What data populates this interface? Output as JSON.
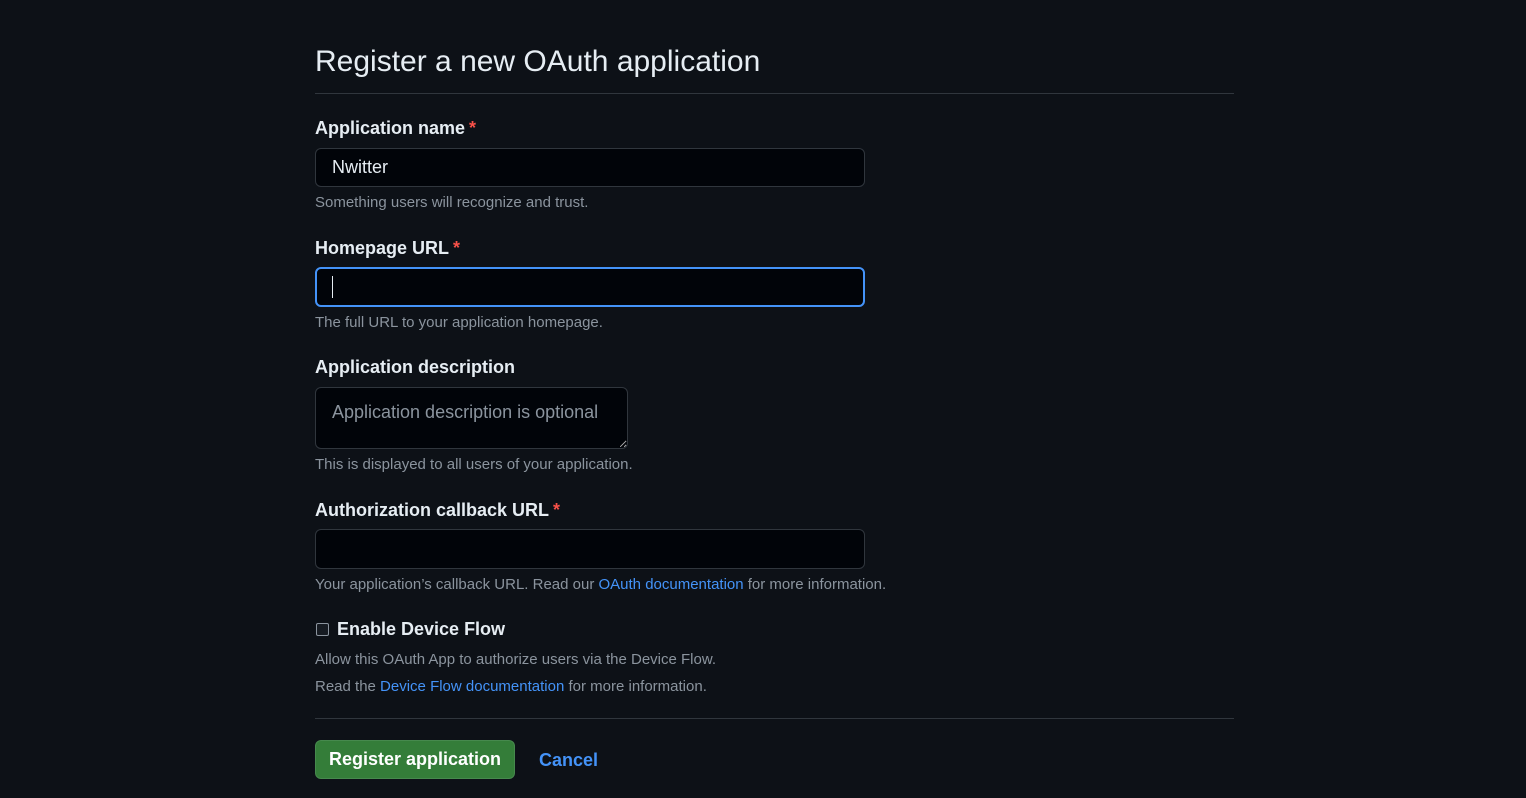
{
  "page": {
    "title": "Register a new OAuth application"
  },
  "form": {
    "app_name": {
      "label": "Application name",
      "required_mark": "*",
      "value": "Nwitter",
      "note": "Something users will recognize and trust."
    },
    "homepage_url": {
      "label": "Homepage URL",
      "required_mark": "*",
      "value": "",
      "note": "The full URL to your application homepage."
    },
    "description": {
      "label": "Application description",
      "placeholder": "Application description is optional",
      "note": "This is displayed to all users of your application."
    },
    "callback_url": {
      "label": "Authorization callback URL",
      "required_mark": "*",
      "value": "",
      "note_prefix": "Your application’s callback URL. Read our ",
      "note_link": "OAuth documentation",
      "note_suffix": " for more information."
    },
    "device_flow": {
      "label": "Enable Device Flow",
      "checked": false,
      "note_line1": "Allow this OAuth App to authorize users via the Device Flow.",
      "note_line2_prefix": "Read the ",
      "note_line2_link": "Device Flow documentation",
      "note_line2_suffix": " for more information."
    }
  },
  "actions": {
    "register_label": "Register application",
    "cancel_label": "Cancel"
  },
  "colors": {
    "background": "#0d1117",
    "input_background": "#010409",
    "required": "#f85149",
    "link": "#4493f8",
    "focus_border": "#4493f8",
    "primary_button": "#347d39"
  }
}
